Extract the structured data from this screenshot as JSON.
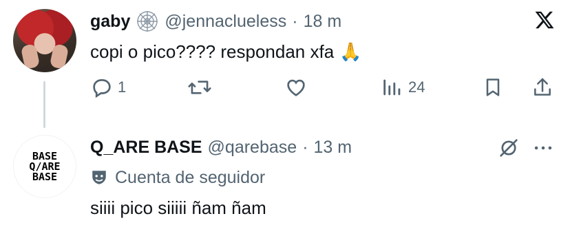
{
  "tweet": {
    "display_name": "gaby",
    "handle": "@jennaclueless",
    "separator": "·",
    "time": "18 m",
    "text": "copi o pico???? respondan xfa",
    "emoji": "🙏",
    "badge_icon": "spiderweb-icon",
    "reply_count": "1",
    "views_count": "24"
  },
  "reply": {
    "display_name": "Q_ARE BASE",
    "handle": "@qarebase",
    "separator": "·",
    "time": "13 m",
    "account_label": "Cuenta de seguidor",
    "text": "siiii pico siiiii ñam ñam",
    "avatar_lines": [
      "BASE",
      "Q/ARE",
      "BASE"
    ]
  },
  "icons": [
    "x-logo-icon",
    "reply-icon",
    "retweet-icon",
    "like-icon",
    "views-icon",
    "bookmark-icon",
    "share-icon",
    "hidden-icon",
    "more-icon",
    "mask-icon"
  ]
}
